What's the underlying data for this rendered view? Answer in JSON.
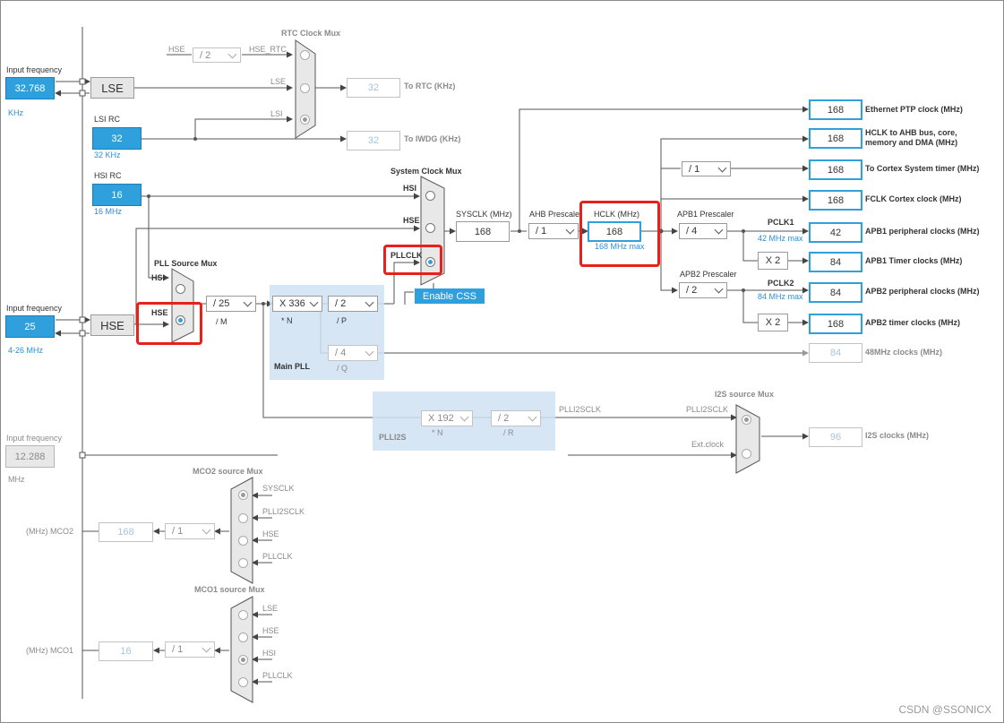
{
  "lse_section": {
    "input_label": "Input frequency",
    "input_value": "32.768",
    "unit": "KHz",
    "osc": "LSE"
  },
  "lsi": {
    "title": "LSI RC",
    "value": "32",
    "unit": "32 KHz"
  },
  "hsi": {
    "title": "HSI RC",
    "value": "16",
    "unit": "16 MHz"
  },
  "hse_section": {
    "input_label": "Input frequency",
    "input_value": "25",
    "range": "4-26 MHz",
    "osc": "HSE"
  },
  "ext_section": {
    "input_label": "Input frequency",
    "input_value": "12.288",
    "unit": "MHz"
  },
  "rtc": {
    "mux_title": "RTC Clock Mux",
    "hse_label": "HSE",
    "div": "/ 2",
    "hse_rtc": "HSE_RTC",
    "in_lse": "LSE",
    "in_lsi": "LSI",
    "out_value": "32",
    "out_label": "To RTC (KHz)",
    "iwdg_value": "32",
    "iwdg_label": "To IWDG (KHz)"
  },
  "sysmux": {
    "title": "System Clock Mux",
    "hsi": "HSI",
    "hse": "HSE",
    "pllclk": "PLLCLK",
    "sysclk_label": "SYSCLK (MHz)",
    "sysclk_value": "168",
    "css": "Enable CSS"
  },
  "pllmux": {
    "title": "PLL Source Mux",
    "hsi": "HSI",
    "hse": "HSE",
    "m_value": "/ 25",
    "m_label": "/ M"
  },
  "mainpll": {
    "title": "Main PLL",
    "n_value": "X 336",
    "n_label": "* N",
    "p_value": "/ 2",
    "p_label": "/ P",
    "q_value": "/ 4",
    "q_label": "/ Q"
  },
  "ahb": {
    "label": "AHB Prescaler",
    "value": "/ 1",
    "hclk_label": "HCLK (MHz)",
    "hclk_value": "168",
    "hclk_max": "168 MHz max"
  },
  "apb1": {
    "label": "APB1 Prescaler",
    "value": "/ 4",
    "pclk": "PCLK1",
    "max": "42 MHz max",
    "timer_mult": "X 2"
  },
  "apb2": {
    "label": "APB2 Prescaler",
    "value": "/ 2",
    "pclk": "PCLK2",
    "max": "84 MHz max",
    "timer_mult": "X 2"
  },
  "cortex_div": "/ 1",
  "outputs": [
    {
      "value": "168",
      "label": "Ethernet PTP clock (MHz)"
    },
    {
      "value": "168",
      "label": "HCLK to AHB bus, core, memory and DMA (MHz)"
    },
    {
      "value": "168",
      "label": "To Cortex System timer (MHz)"
    },
    {
      "value": "168",
      "label": "FCLK Cortex clock (MHz)"
    },
    {
      "value": "42",
      "label": "APB1 peripheral clocks (MHz)"
    },
    {
      "value": "84",
      "label": "APB1 Timer clocks (MHz)"
    },
    {
      "value": "84",
      "label": "APB2 peripheral clocks (MHz)"
    },
    {
      "value": "168",
      "label": "APB2 timer clocks (MHz)"
    },
    {
      "value": "84",
      "label": "48MHz clocks (MHz)"
    },
    {
      "value": "96",
      "label": "I2S clocks (MHz)"
    }
  ],
  "plli2s": {
    "title": "PLLI2S",
    "n_value": "X 192",
    "n_label": "* N",
    "r_value": "/ 2",
    "r_label": "/ R",
    "out": "PLLI2SCLK"
  },
  "i2smux": {
    "title": "I2S source Mux",
    "in1": "PLLI2SCLK",
    "in2": "Ext.clock"
  },
  "mco2": {
    "title": "MCO2 source Mux",
    "in": [
      "SYSCLK",
      "PLLI2SCLK",
      "HSE",
      "PLLCLK"
    ],
    "div": "/ 1",
    "value": "168",
    "label": "(MHz) MCO2"
  },
  "mco1": {
    "title": "MCO1 source Mux",
    "in": [
      "LSE",
      "HSE",
      "HSI",
      "PLLCLK"
    ],
    "div": "/ 1",
    "value": "16",
    "label": "(MHz) MCO1"
  },
  "watermark": "CSDN @SSONICX",
  "colors": {
    "accent": "#2fa0dc",
    "highlight": "#e8201c",
    "panel": "#cfe2f3"
  }
}
